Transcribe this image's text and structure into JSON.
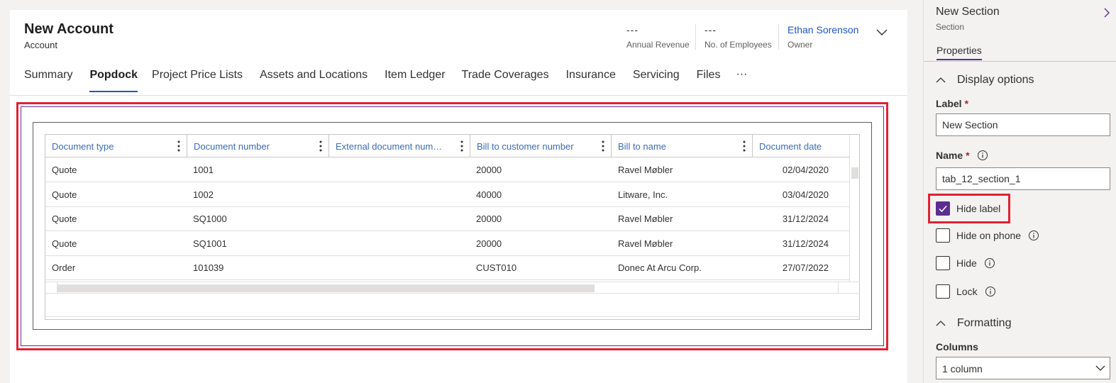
{
  "header": {
    "title": "New Account",
    "entity": "Account",
    "fields": [
      {
        "value": "---",
        "label": "Annual Revenue"
      },
      {
        "value": "---",
        "label": "No. of Employees"
      }
    ],
    "owner": {
      "value": "Ethan Sorenson",
      "label": "Owner"
    }
  },
  "tabs": [
    "Summary",
    "Popdock",
    "Project Price Lists",
    "Assets and Locations",
    "Item Ledger",
    "Trade Coverages",
    "Insurance",
    "Servicing",
    "Files"
  ],
  "active_tab": "Popdock",
  "more_tabs_label": "···",
  "grid": {
    "columns": [
      "Document type",
      "Document number",
      "External document num…",
      "Bill to customer number",
      "Bill to name",
      "Document date"
    ],
    "rows": [
      [
        "Quote",
        "1001",
        "",
        "20000",
        "Ravel Møbler",
        "02/04/2020"
      ],
      [
        "Quote",
        "1002",
        "",
        "40000",
        "Litware, Inc.",
        "03/04/2020"
      ],
      [
        "Quote",
        "SQ1000",
        "",
        "20000",
        "Ravel Møbler",
        "31/12/2024"
      ],
      [
        "Quote",
        "SQ1001",
        "",
        "20000",
        "Ravel Møbler",
        "31/12/2024"
      ],
      [
        "Order",
        "101039",
        "",
        "CUST010",
        "Donec At Arcu Corp.",
        "27/07/2022"
      ]
    ]
  },
  "panel": {
    "title": "New Section",
    "subtitle": "Section",
    "tab": "Properties",
    "display_group": "Display options",
    "label_field": {
      "label": "Label",
      "required_mark": "*",
      "value": "New Section"
    },
    "name_field": {
      "label": "Name",
      "required_mark": "*",
      "value": "tab_12_section_1"
    },
    "checkboxes": [
      {
        "label": "Hide label",
        "checked": true
      },
      {
        "label": "Hide on phone",
        "checked": false
      },
      {
        "label": "Hide",
        "checked": false
      },
      {
        "label": "Lock",
        "checked": false
      }
    ],
    "formatting_group": "Formatting",
    "columns_field": {
      "label": "Columns",
      "value": "1 column"
    }
  },
  "colors": {
    "accent": "#5c2e91",
    "highlight": "#e02233",
    "link": "#1d56c4"
  }
}
